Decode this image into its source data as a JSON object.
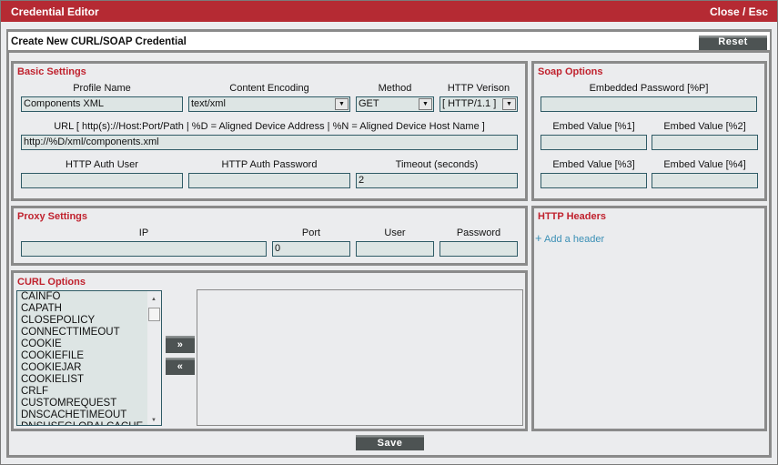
{
  "window": {
    "title": "Credential Editor",
    "close_label": "Close / Esc"
  },
  "header": {
    "title": "Create New CURL/SOAP Credential",
    "reset_label": "Reset"
  },
  "basic": {
    "title": "Basic Settings",
    "profile_name_label": "Profile Name",
    "profile_name": "Components XML",
    "content_encoding_label": "Content Encoding",
    "content_encoding": "text/xml",
    "method_label": "Method",
    "method": "GET",
    "http_version_label": "HTTP Verison",
    "http_version": "[ HTTP/1.1 ]",
    "url_label": "URL [ http(s)://Host:Port/Path | %D = Aligned Device Address | %N = Aligned Device Host Name ]",
    "url": "http://%D/xml/components.xml",
    "auth_user_label": "HTTP Auth User",
    "auth_user": "",
    "auth_password_label": "HTTP Auth Password",
    "auth_password": "",
    "timeout_label": "Timeout (seconds)",
    "timeout": "2"
  },
  "soap": {
    "title": "Soap Options",
    "embedded_password_label": "Embedded Password [%P]",
    "embedded_password": "",
    "embed1_label": "Embed Value [%1]",
    "embed2_label": "Embed Value [%2]",
    "embed3_label": "Embed Value [%3]",
    "embed4_label": "Embed Value [%4]"
  },
  "proxy": {
    "title": "Proxy Settings",
    "ip_label": "IP",
    "ip": "",
    "port_label": "Port",
    "port": "0",
    "user_label": "User",
    "user": "",
    "password_label": "Password",
    "password": ""
  },
  "headers": {
    "title": "HTTP Headers",
    "add_label": "Add a header",
    "add_icon": "+"
  },
  "curl": {
    "title": "CURL Options",
    "add_label": "»",
    "remove_label": "«",
    "options": [
      "CAINFO",
      "CAPATH",
      "CLOSEPOLICY",
      "CONNECTTIMEOUT",
      "COOKIE",
      "COOKIEFILE",
      "COOKIEJAR",
      "COOKIELIST",
      "CRLF",
      "CUSTOMREQUEST",
      "DNSCACHETIMEOUT",
      "DNSUSEGLOBALCACHE"
    ]
  },
  "footer": {
    "save_label": "Save"
  },
  "colors": {
    "title_bar": "#b52a33",
    "section_title": "#c0222e",
    "button": "#4d5353",
    "input_bg": "#dde5e4",
    "link": "#3a8fb5"
  }
}
